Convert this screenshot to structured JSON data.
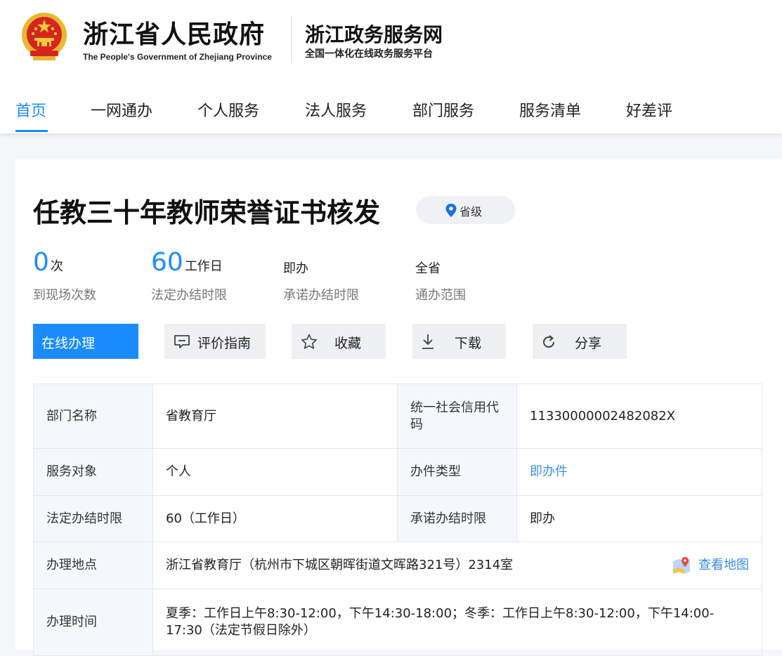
{
  "header": {
    "gov_title": "浙江省人民政府",
    "gov_subtitle": "The People's Government of Zhejiang Province",
    "service_title": "浙江政务服务网",
    "service_subtitle": "全国一体化在线政务服务平台"
  },
  "nav": {
    "items": [
      {
        "label": "首页",
        "active": true
      },
      {
        "label": "一网通办"
      },
      {
        "label": "个人服务"
      },
      {
        "label": "法人服务"
      },
      {
        "label": "部门服务"
      },
      {
        "label": "服务清单"
      },
      {
        "label": "好差评"
      }
    ]
  },
  "item": {
    "title": "任教三十年教师荣誉证书核发",
    "level_badge": "省级",
    "stats": [
      {
        "value": "0",
        "unit": "次",
        "label": "到现场次数"
      },
      {
        "value": "60",
        "unit": "工作日",
        "label": "法定办结时限"
      },
      {
        "value": "即办",
        "label": "承诺办结时限"
      },
      {
        "value": "全省",
        "label": "通办范围"
      }
    ]
  },
  "actions": {
    "online": "在线办理",
    "evaluate": "评价指南",
    "favorite": "收藏",
    "download": "下载",
    "share": "分享"
  },
  "info_table": {
    "dept_name_label": "部门名称",
    "dept_name": "省教育厅",
    "credit_code_label": "统一社会信用代码",
    "credit_code": "11330000002482082X",
    "target_label": "服务对象",
    "target": "个人",
    "type_label": "办件类型",
    "type": "即办件",
    "legal_limit_label": "法定办结时限",
    "legal_limit": "60（工作日）",
    "promise_limit_label": "承诺办结时限",
    "promise_limit": "即办",
    "location_label": "办理地点",
    "location": "浙江省教育厅（杭州市下城区朝晖街道文晖路321号）2314室",
    "view_map": "查看地图",
    "time_label": "办理时间",
    "time": "夏季：工作日上午8:30-12:00，下午14:30-18:00；冬季：工作日上午8:30-12:00，下午14:00-17:30（法定节假日除外）"
  },
  "colors": {
    "accent": "#1a8cff",
    "link": "#3a8ee6",
    "table_key_bg": "#f4f8fc",
    "button_bg": "#eff0f2"
  },
  "icons": [
    "national-emblem-icon",
    "location-pin-icon",
    "arrow-right-icon",
    "comment-icon",
    "star-icon",
    "download-icon",
    "share-icon",
    "map-icon"
  ]
}
